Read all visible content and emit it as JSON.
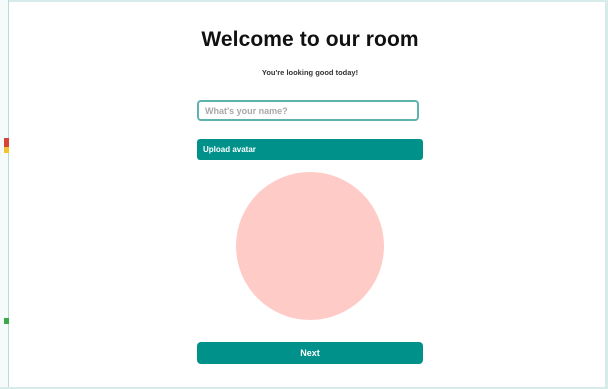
{
  "page": {
    "title": "Welcome to our room",
    "subtitle": "You're looking good today!"
  },
  "form": {
    "name_placeholder": "What's your name?",
    "name_value": "",
    "upload_label": "Upload avatar",
    "next_label": "Next"
  },
  "colors": {
    "accent": "#00928a",
    "input_border": "#5fb3ad",
    "avatar_fill": "#ffcbc7",
    "title_text": "#111111"
  }
}
